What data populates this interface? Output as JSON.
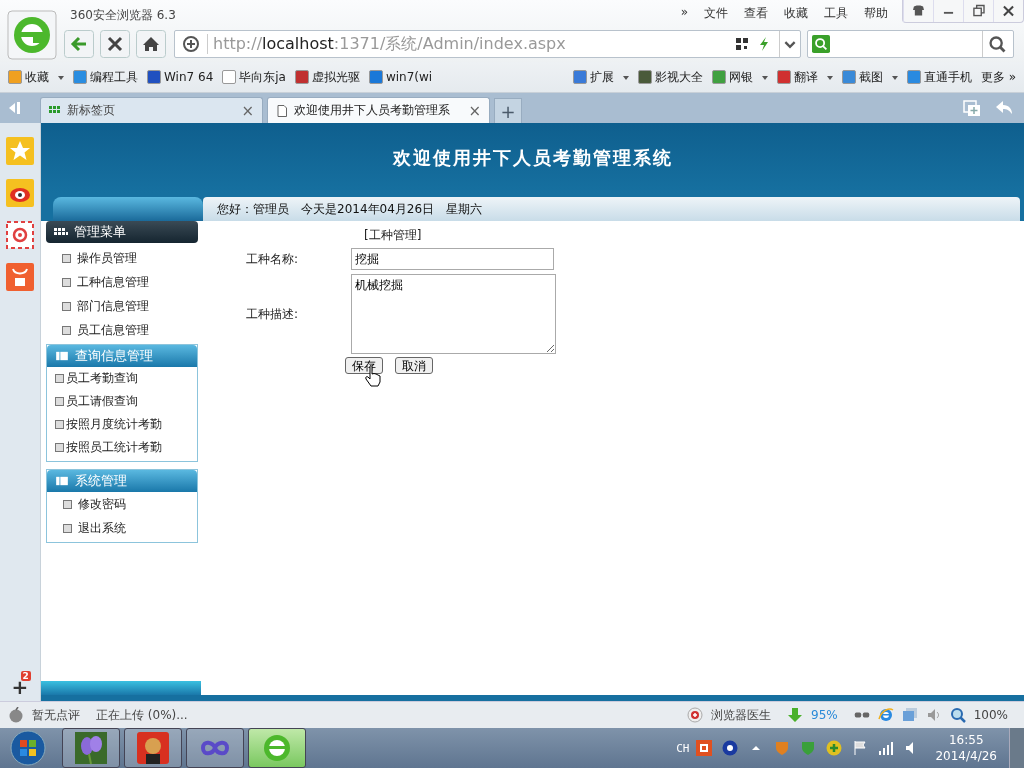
{
  "window": {
    "title": "360安全浏览器 6.3"
  },
  "menu": [
    "»",
    "文件",
    "查看",
    "收藏",
    "工具",
    "帮助"
  ],
  "address_bar": {
    "scheme": "http://",
    "host": "localhost",
    "rest": ":1371/系统/Admin/index.aspx"
  },
  "bookmarks": [
    {
      "label": "收藏",
      "dropdown": true
    },
    {
      "label": "编程工具",
      "dropdown": false
    },
    {
      "label": "Win7 64",
      "dropdown": false
    },
    {
      "label": "毕向东ja",
      "dropdown": false
    },
    {
      "label": "虚拟光驱",
      "dropdown": false
    },
    {
      "label": "win7(wi",
      "dropdown": false
    }
  ],
  "extensions": [
    {
      "label": "扩展",
      "dropdown": true
    },
    {
      "label": "影视大全",
      "dropdown": false
    },
    {
      "label": "网银",
      "dropdown": true
    },
    {
      "label": "翻译",
      "dropdown": true
    },
    {
      "label": "截图",
      "dropdown": true
    },
    {
      "label": "直通手机",
      "dropdown": false
    }
  ],
  "more": {
    "label": "更多",
    "arrow": "»"
  },
  "tabs": [
    {
      "label": "新标签页",
      "selected": false,
      "close": "×"
    },
    {
      "label": "欢迎使用井下人员考勤管理系",
      "selected": true,
      "close": "×"
    }
  ],
  "new_tab": "+",
  "side_add": {
    "label": "+",
    "badge": "2"
  },
  "page": {
    "title": "欢迎使用井下人员考勤管理系统",
    "greeting": "您好：管理员　今天是2014年04月26日　星期六",
    "menu_groups": [
      {
        "kind": "dark",
        "title": "管理菜单",
        "items": [
          "操作员管理",
          "工种信息管理",
          "部门信息管理",
          "员工信息管理"
        ]
      },
      {
        "kind": "panel",
        "title": "查询信息管理",
        "items": [
          "员工考勤查询",
          "员工请假查询",
          "按照月度统计考勤",
          "按照员工统计考勤"
        ]
      },
      {
        "kind": "panel",
        "title": "系统管理",
        "items": [
          "修改密码",
          "退出系统"
        ]
      }
    ],
    "form": {
      "heading": "[工种管理]",
      "name_label": "工种名称:",
      "name_value": "挖掘",
      "desc_label": "工种描述:",
      "desc_value": "机械挖掘",
      "buttons": [
        "保存",
        "取消"
      ]
    }
  },
  "status_bar": {
    "rating": "暂无点评",
    "upload": "正在上传 (0%)...",
    "doctor": "浏览器医生",
    "speed": "95%",
    "zoom": "100%"
  },
  "taskbar": {
    "ime": "CH",
    "time": "16:55",
    "date": "2014/4/26"
  }
}
